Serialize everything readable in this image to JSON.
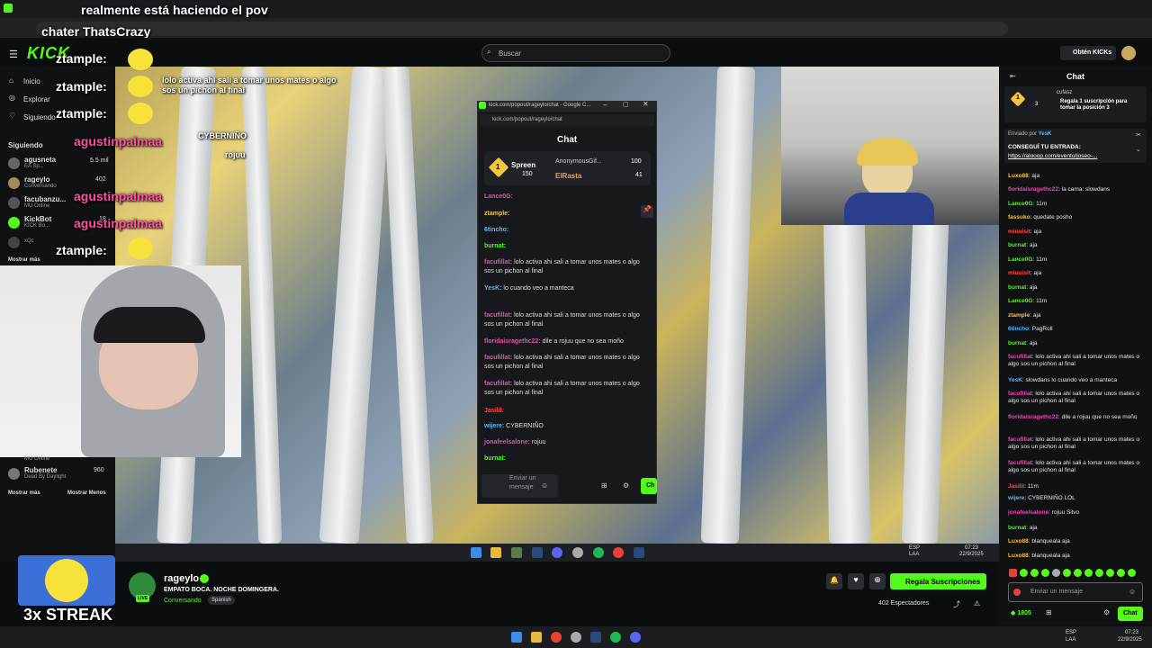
{
  "browser": {
    "overlay_line1": "realmente está haciendo el pov",
    "overlay_line2": "chater ThatsCrazy"
  },
  "header": {
    "logo": "KICK",
    "search_placeholder": "Buscar",
    "kicks_button": "Obtén KICKs"
  },
  "sidebar": {
    "nav": [
      {
        "label": "Inicio"
      },
      {
        "label": "Explorar"
      },
      {
        "label": "Siguiendo"
      }
    ],
    "section_title": "Siguiendo",
    "channels": [
      {
        "name": "agusneta",
        "sub": "EA Sp...",
        "viewers": "5.5 mil"
      },
      {
        "name": "rageylo",
        "sub": "Conversando",
        "viewers": "402"
      },
      {
        "name": "facubanzu...",
        "sub": "MU Online",
        "viewers": ""
      },
      {
        "name": "KickBot",
        "sub": "KICK Bo...",
        "viewers": "18"
      },
      {
        "name": "xQc",
        "sub": "",
        "viewers": ""
      }
    ],
    "show_more": "Mostrar más",
    "bottom_channel": {
      "name": "Rubenete",
      "sub": "Dead By Daylight",
      "viewers": "960",
      "top_sub": "MU Online"
    },
    "show_more2": "Mostrar más",
    "show_less": "Mostrar Menos"
  },
  "overlay_chat": [
    {
      "user": "ztample:"
    },
    {
      "user": "ztample:"
    },
    {
      "user": "ztample:"
    },
    {
      "user": "agustinpalmaa"
    },
    {
      "user": "agustinpalmaa"
    },
    {
      "user": "agustinpalmaa"
    },
    {
      "user": "ztample:"
    }
  ],
  "overlay_msgs": {
    "m1": "lolo activa ahi sali a tomar unos mates o algo sos un pichon al final",
    "m2": "CYBERNIÑO",
    "m3": "rojuu"
  },
  "popup": {
    "window_title": "kick.com/popout/rageylo/chat - Google C...",
    "url": "kick.com/popout/rageylo/chat",
    "title": "Chat",
    "top1": {
      "name": "Spreen",
      "count": "150",
      "rank": "1"
    },
    "top2": {
      "name": "AnonymousGif...",
      "count": "100"
    },
    "top3": {
      "name": "ElRasta",
      "count": "41"
    },
    "messages": [
      {
        "user": "Lance0G:",
        "text": ""
      },
      {
        "user": "ztample:",
        "text": ""
      },
      {
        "user": "6tincho:",
        "text": ""
      },
      {
        "user": "burnat:",
        "text": ""
      },
      {
        "user": "facufillat:",
        "text": "lolo activa ahi sali a tomar unos mates o algo sos un pichon al final"
      },
      {
        "user": "YesK:",
        "text": "lo cuando veo a manteca"
      },
      {
        "user": "facufillat:",
        "text": "lolo activa ahi sali a tomar unos mates o algo sos un pichon al final"
      },
      {
        "user": "floridaisragethc22:",
        "text": "dile a rojuu que no sea moño"
      },
      {
        "user": "facufillat:",
        "text": "lolo activa ahi sali a tomar unos mates o algo sos un pichon al final"
      },
      {
        "user": "facufillat:",
        "text": "lolo activa ahi sali a tomar unos mates o algo sos un pichon al final"
      },
      {
        "user": "Jasilil:",
        "text": ""
      },
      {
        "user": "wijere:",
        "text": "CYBERNIÑO"
      },
      {
        "user": "jonafeelsalone:",
        "text": "rojuu"
      },
      {
        "user": "burnat:",
        "text": ""
      }
    ],
    "input_placeholder": "Enviar un mensaje",
    "chat_button": "Ch"
  },
  "taskbar_inner": {
    "lang": "ESP",
    "lang2": "LAA",
    "time": "07:23",
    "date": "22/9/2025"
  },
  "channel_info": {
    "name": "rageylo",
    "title": "EMPATO BOCA. NOCHE DOMINGERA.",
    "category": "Conversando",
    "tag": "Spanish",
    "live": "LIVE",
    "subs_button": "Regala Suscripciones",
    "viewers": "402 Espectadores"
  },
  "streak": "3x STREAK",
  "right_chat": {
    "title": "Chat",
    "pinned_user": "cufasz",
    "pinned_count": "3",
    "pinned_rank": "1",
    "gift_text": "Regala 1 suscripción para tomar la posición 3",
    "sent_by": "Enviado por",
    "sent_by_user": "YesK",
    "promo_title": "CONSEGUÍ TU ENTRADA:",
    "promo_link": "https://alooop.com/evento/joseo-...",
    "messages": [
      {
        "user": "Luxo88",
        "text": "aja",
        "color": "#f4c542"
      },
      {
        "user": "floridaisragethc22",
        "text": "la cama: slowdans",
        "color": "#e94cb5"
      },
      {
        "user": "Lance0G",
        "text": "11m",
        "color": "#53fc18"
      },
      {
        "user": "fassuko",
        "text": "quedate posho",
        "color": "#f4c542"
      },
      {
        "user": "miuuisit",
        "text": "aja",
        "color": "#ff4d4d"
      },
      {
        "user": "burnat",
        "text": "aja",
        "color": "#53fc18"
      },
      {
        "user": "Lance0G",
        "text": "11m",
        "color": "#53fc18"
      },
      {
        "user": "miuuisit",
        "text": "aja",
        "color": "#ff4d4d"
      },
      {
        "user": "burnat",
        "text": "aja",
        "color": "#53fc18"
      },
      {
        "user": "Lance0G",
        "text": "11m",
        "color": "#53fc18"
      },
      {
        "user": "ztample",
        "text": "aja",
        "color": "#f4c542"
      },
      {
        "user": "6tincho",
        "text": "PagRoll",
        "color": "#5ab8ff"
      },
      {
        "user": "burnat",
        "text": "aja",
        "color": "#53fc18"
      },
      {
        "user": "facufillat",
        "text": "lolo activa ahi sali a tomar unos mates o algo sos un pichon al final",
        "color": "#e94cb5"
      },
      {
        "user": "YesK",
        "text": "slowdans lo cuando veo a manteca",
        "color": "#5ab8ff"
      },
      {
        "user": "facufillat",
        "text": "lolo activa ahi sali a tomar unos mates o algo sos un pichon al final",
        "color": "#e94cb5"
      },
      {
        "user": "floridaisragethc22",
        "text": "dile a rojuu que no sea moño",
        "color": "#e94cb5"
      },
      {
        "user": "facufillat",
        "text": "lolo activa ahi sali a tomar unos mates o algo sos un pichon al final",
        "color": "#e94cb5"
      },
      {
        "user": "facufillat",
        "text": "lolo activa ahi sali a tomar unos mates o algo sos un pichon al final",
        "color": "#e94cb5"
      },
      {
        "user": "Jasilil",
        "text": "11m",
        "color": "#ff4d4d"
      },
      {
        "user": "wijere",
        "text": "CYBERNIÑO LOL",
        "color": "#5ab8ff"
      },
      {
        "user": "jonafeelsalone",
        "text": "rojuu Silvo",
        "color": "#e94cb5"
      },
      {
        "user": "burnat",
        "text": "aja",
        "color": "#53fc18"
      },
      {
        "user": "Luxo88",
        "text": "blanqueala aja",
        "color": "#f4c542"
      },
      {
        "user": "Luxo88",
        "text": "blanqueala aja",
        "color": "#f4c542"
      }
    ],
    "input_placeholder": "Enviar un mensaje",
    "kicks_count": "1805",
    "chat_button": "Chat"
  },
  "win_taskbar": {
    "lang": "ESP",
    "lang2": "LAA",
    "time": "07:23",
    "date": "22/9/2025"
  }
}
